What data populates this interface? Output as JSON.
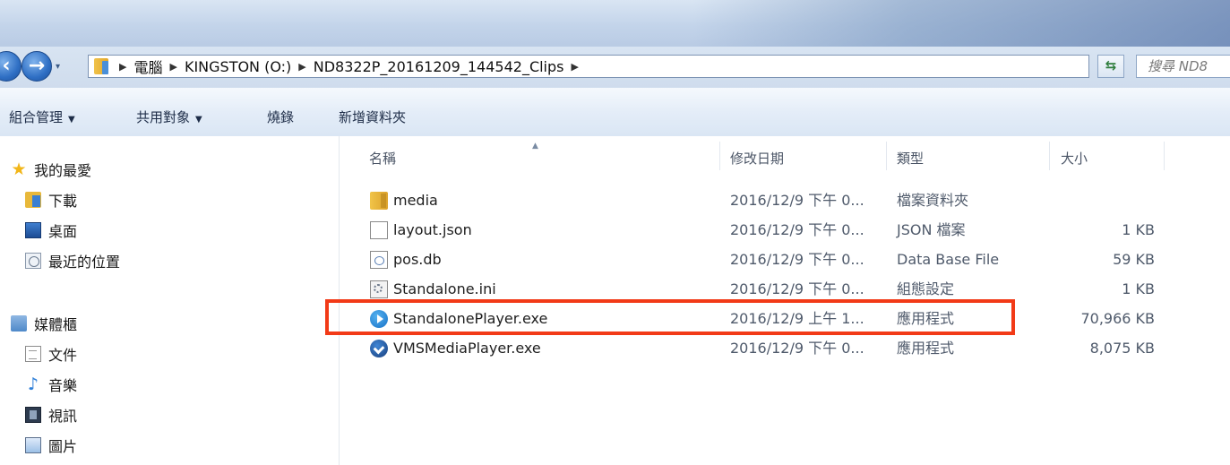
{
  "address_bar": {
    "crumbs": [
      "電腦",
      "KINGSTON (O:)",
      "ND8322P_20161209_144542_Clips"
    ],
    "search_placeholder": "搜尋 ND8"
  },
  "toolbar": {
    "organize": "組合管理",
    "share": "共用對象",
    "burn": "燒錄",
    "new_folder": "新增資料夾"
  },
  "nav": {
    "favorites": {
      "label": "我的最愛",
      "items": [
        {
          "label": "下載",
          "icon": "download-folder-icon"
        },
        {
          "label": "桌面",
          "icon": "desktop-icon"
        },
        {
          "label": "最近的位置",
          "icon": "recent-places-icon"
        }
      ]
    },
    "libraries": {
      "label": "媒體櫃",
      "items": [
        {
          "label": "文件",
          "icon": "documents-icon"
        },
        {
          "label": "音樂",
          "icon": "music-icon"
        },
        {
          "label": "視訊",
          "icon": "video-icon"
        },
        {
          "label": "圖片",
          "icon": "pictures-icon"
        }
      ]
    }
  },
  "columns": {
    "name": "名稱",
    "date": "修改日期",
    "type": "類型",
    "size": "大小"
  },
  "files": [
    {
      "name": "media",
      "date": "2016/12/9 下午 0...",
      "type": "檔案資料夾",
      "size": "",
      "icon": "folder-icon"
    },
    {
      "name": "layout.json",
      "date": "2016/12/9 下午 0...",
      "type": "JSON 檔案",
      "size": "1 KB",
      "icon": "file-icon"
    },
    {
      "name": "pos.db",
      "date": "2016/12/9 下午 0...",
      "type": "Data Base File",
      "size": "59 KB",
      "icon": "database-file-icon"
    },
    {
      "name": "Standalone.ini",
      "date": "2016/12/9 下午 0...",
      "type": "組態設定",
      "size": "1 KB",
      "icon": "settings-file-icon"
    },
    {
      "name": "StandalonePlayer.exe",
      "date": "2016/12/9 上午 1...",
      "type": "應用程式",
      "size": "70,966 KB",
      "icon": "player-app-icon"
    },
    {
      "name": "VMSMediaPlayer.exe",
      "date": "2016/12/9 下午 0...",
      "type": "應用程式",
      "size": "8,075 KB",
      "icon": "vms-app-icon"
    }
  ],
  "highlight_color": "#f23a17"
}
